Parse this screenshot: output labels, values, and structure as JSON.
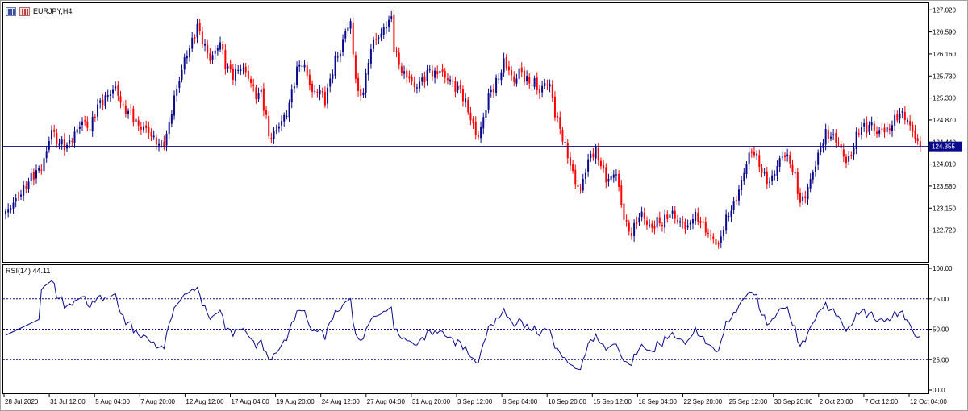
{
  "window": {
    "symbol_label": "EURJPY,H4",
    "icons": [
      "chart-window-icon",
      "chart-window-red-icon"
    ]
  },
  "rsi": {
    "label": "RSI(14) 44.11",
    "levels": [
      75,
      50,
      25
    ],
    "scale_labels": [
      "100.00",
      "75.00",
      "50.00",
      "25.00",
      "0.00"
    ]
  },
  "colors": {
    "bull": "#0a0a8c",
    "bear": "#ff0000",
    "rsi": "#0a0a8c",
    "price_line": "#0a0a8c",
    "price_tag_bg": "#0a0a8c"
  },
  "chart_data": [
    {
      "type": "candlestick",
      "title": "EURJPY,H4",
      "ylim": [
        122.1,
        127.15
      ],
      "y_tick_labels": [
        "127.020",
        "126.590",
        "126.160",
        "125.730",
        "125.300",
        "124.870",
        "124.440",
        "124.010",
        "123.580",
        "123.150",
        "122.720"
      ],
      "x_tick_labels": [
        "28 Jul 2020",
        "31 Jul 12:00",
        "5 Aug 04:00",
        "7 Aug 20:00",
        "12 Aug 12:00",
        "17 Aug 04:00",
        "19 Aug 20:00",
        "24 Aug 12:00",
        "27 Aug 04:00",
        "31 Aug 20:00",
        "3 Sep 12:00",
        "8 Sep 04:00",
        "10 Sep 20:00",
        "15 Sep 12:00",
        "18 Sep 04:00",
        "22 Sep 20:00",
        "25 Sep 12:00",
        "30 Sep 20:00",
        "2 Oct 20:00",
        "7 Oct 12:00",
        "12 Oct 04:00"
      ],
      "current_price": "124.355",
      "close_path": [
        [
          0,
          123.05
        ],
        [
          6,
          123.45
        ],
        [
          10,
          123.75
        ],
        [
          14,
          123.95
        ],
        [
          16,
          124.25
        ],
        [
          18,
          124.7
        ],
        [
          20,
          124.45
        ],
        [
          24,
          124.35
        ],
        [
          27,
          124.6
        ],
        [
          30,
          124.85
        ],
        [
          33,
          124.7
        ],
        [
          36,
          125.15
        ],
        [
          40,
          125.35
        ],
        [
          43,
          125.5
        ],
        [
          46,
          125.1
        ],
        [
          49,
          125.0
        ],
        [
          52,
          124.75
        ],
        [
          55,
          124.7
        ],
        [
          58,
          124.5
        ],
        [
          61,
          124.35
        ],
        [
          63,
          124.55
        ],
        [
          66,
          125.3
        ],
        [
          68,
          125.65
        ],
        [
          70,
          126.05
        ],
        [
          73,
          126.4
        ],
        [
          75,
          126.7
        ],
        [
          78,
          126.3
        ],
        [
          80,
          126.05
        ],
        [
          82,
          126.2
        ],
        [
          84,
          126.4
        ],
        [
          86,
          125.95
        ],
        [
          89,
          125.75
        ],
        [
          92,
          125.9
        ],
        [
          94,
          125.8
        ],
        [
          96,
          125.6
        ],
        [
          98,
          125.35
        ],
        [
          100,
          125.4
        ],
        [
          102,
          124.9
        ],
        [
          103,
          124.55
        ],
        [
          105,
          124.6
        ],
        [
          108,
          124.85
        ],
        [
          110,
          125.0
        ],
        [
          112,
          125.4
        ],
        [
          114,
          125.85
        ],
        [
          116,
          126.0
        ],
        [
          118,
          125.75
        ],
        [
          120,
          125.4
        ],
        [
          123,
          125.45
        ],
        [
          125,
          125.25
        ],
        [
          127,
          125.65
        ],
        [
          129,
          126.05
        ],
        [
          131,
          126.2
        ],
        [
          133,
          126.6
        ],
        [
          135,
          126.8
        ],
        [
          136,
          126.1
        ],
        [
          138,
          125.4
        ],
        [
          139,
          125.3
        ],
        [
          141,
          125.7
        ],
        [
          143,
          126.3
        ],
        [
          145,
          126.45
        ],
        [
          147,
          126.55
        ],
        [
          149,
          126.75
        ],
        [
          151,
          126.85
        ],
        [
          152,
          126.3
        ],
        [
          154,
          125.95
        ],
        [
          156,
          125.75
        ],
        [
          158,
          125.7
        ],
        [
          160,
          125.5
        ],
        [
          162,
          125.6
        ],
        [
          164,
          125.7
        ],
        [
          166,
          125.85
        ],
        [
          168,
          125.75
        ],
        [
          170,
          125.85
        ],
        [
          172,
          125.7
        ],
        [
          174,
          125.65
        ],
        [
          176,
          125.5
        ],
        [
          178,
          125.45
        ],
        [
          180,
          125.2
        ],
        [
          182,
          124.9
        ],
        [
          184,
          124.6
        ],
        [
          185,
          124.55
        ],
        [
          187,
          124.9
        ],
        [
          189,
          125.35
        ],
        [
          191,
          125.5
        ],
        [
          193,
          125.7
        ],
        [
          195,
          126.0
        ],
        [
          197,
          125.85
        ],
        [
          199,
          125.6
        ],
        [
          201,
          125.85
        ],
        [
          203,
          125.7
        ],
        [
          205,
          125.6
        ],
        [
          207,
          125.6
        ],
        [
          209,
          125.4
        ],
        [
          211,
          125.6
        ],
        [
          213,
          125.55
        ],
        [
          215,
          125.0
        ],
        [
          217,
          124.7
        ],
        [
          219,
          124.35
        ],
        [
          221,
          124.0
        ],
        [
          223,
          123.65
        ],
        [
          225,
          123.5
        ],
        [
          227,
          123.9
        ],
        [
          229,
          124.2
        ],
        [
          231,
          124.25
        ],
        [
          233,
          124.0
        ],
        [
          235,
          123.7
        ],
        [
          237,
          123.75
        ],
        [
          239,
          123.85
        ],
        [
          241,
          123.2
        ],
        [
          243,
          122.8
        ],
        [
          245,
          122.65
        ],
        [
          247,
          122.9
        ],
        [
          249,
          123.05
        ],
        [
          251,
          122.85
        ],
        [
          253,
          122.75
        ],
        [
          255,
          122.9
        ],
        [
          257,
          122.85
        ],
        [
          259,
          123.0
        ],
        [
          261,
          123.05
        ],
        [
          263,
          122.9
        ],
        [
          265,
          122.85
        ],
        [
          267,
          122.75
        ],
        [
          269,
          123.0
        ],
        [
          271,
          122.95
        ],
        [
          273,
          122.8
        ],
        [
          275,
          122.65
        ],
        [
          277,
          122.55
        ],
        [
          279,
          122.4
        ],
        [
          281,
          122.8
        ],
        [
          283,
          123.05
        ],
        [
          285,
          123.2
        ],
        [
          287,
          123.5
        ],
        [
          289,
          123.85
        ],
        [
          291,
          124.2
        ],
        [
          293,
          124.25
        ],
        [
          295,
          124.0
        ],
        [
          297,
          123.75
        ],
        [
          299,
          123.65
        ],
        [
          301,
          123.85
        ],
        [
          303,
          124.1
        ],
        [
          305,
          124.2
        ],
        [
          307,
          124.05
        ],
        [
          309,
          123.75
        ],
        [
          311,
          123.25
        ],
        [
          313,
          123.4
        ],
        [
          315,
          123.7
        ],
        [
          317,
          124.0
        ],
        [
          319,
          124.35
        ],
        [
          321,
          124.6
        ],
        [
          323,
          124.55
        ],
        [
          325,
          124.5
        ],
        [
          327,
          124.3
        ],
        [
          329,
          124.05
        ],
        [
          331,
          124.2
        ],
        [
          333,
          124.55
        ],
        [
          335,
          124.75
        ],
        [
          337,
          124.7
        ],
        [
          339,
          124.8
        ],
        [
          341,
          124.6
        ],
        [
          343,
          124.7
        ],
        [
          345,
          124.65
        ],
        [
          347,
          124.8
        ],
        [
          349,
          124.95
        ],
        [
          351,
          125.0
        ],
        [
          353,
          124.85
        ],
        [
          355,
          124.65
        ],
        [
          357,
          124.4
        ],
        [
          358,
          124.36
        ]
      ]
    },
    {
      "type": "line",
      "title": "RSI(14) 44.11",
      "ylim": [
        0,
        100
      ],
      "y_tick_labels": [
        "100.00",
        "75.00",
        "50.00",
        "25.00",
        "0.00"
      ],
      "reference_levels": [
        75,
        50,
        25
      ],
      "last_value": 44.11
    }
  ]
}
